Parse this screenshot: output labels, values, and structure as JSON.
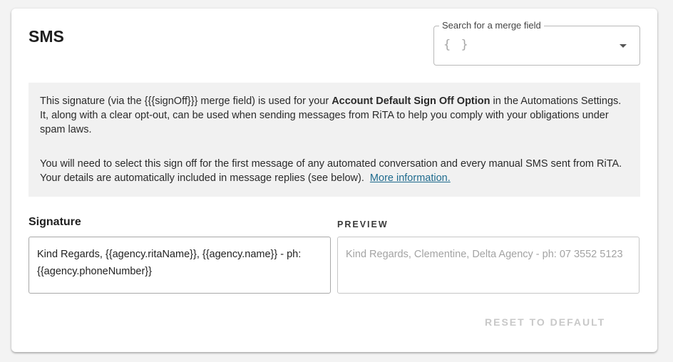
{
  "section": {
    "title": "SMS"
  },
  "merge_field": {
    "label": "Search for a merge field",
    "icon_text": "{ }",
    "icon": "curly-braces-icon",
    "dropdown_icon": "caret-down-icon"
  },
  "info": {
    "p1_before": "This signature (via the {{{signOff}}} merge field) is used for your ",
    "p1_bold": "Account Default Sign Off Option",
    "p1_after": " in the Automations Settings. It, along with a clear opt-out, can be used when sending messages from RiTA to help you comply with your obligations under spam laws.",
    "p2_text": "You will need to select this sign off for the first message of any automated conversation and every manual SMS sent from RiTA. Your details are automatically included in message replies (see below).",
    "p2_link": "More information."
  },
  "signature": {
    "label": "Signature",
    "value": "Kind Regards, {{agency.ritaName}}, {{agency.name}} - ph: {{agency.phoneNumber}}"
  },
  "preview": {
    "label": "PREVIEW",
    "text": "Kind Regards, Clementine, Delta Agency - ph: 07 3552 5123"
  },
  "actions": {
    "reset_label": "RESET TO DEFAULT"
  },
  "colors": {
    "link": "#1f6b8e",
    "info_bg": "#f1f1f1",
    "disabled_text": "#c8c8c8"
  }
}
